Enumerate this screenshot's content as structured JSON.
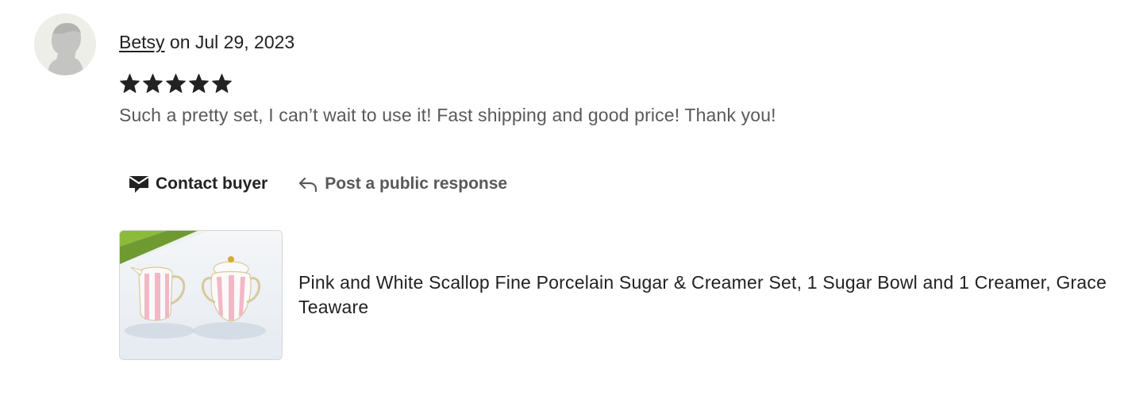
{
  "review": {
    "reviewer_name": "Betsy",
    "date_text": "on Jul 29, 2023",
    "rating": 5,
    "rating_max": 5,
    "text": "Such a pretty set, I can’t wait to use it! Fast shipping and good price! Thank you!"
  },
  "actions": {
    "contact_label": "Contact buyer",
    "public_response_label": "Post a public response"
  },
  "listing": {
    "title": "Pink and White Scallop Fine Porcelain Sugar & Creamer Set, 1 Sugar Bowl and 1 Creamer, Grace Teaware"
  },
  "icons": {
    "avatar": "default-user-avatar-icon",
    "star": "star-filled-icon",
    "contact": "envelope-message-icon",
    "reply": "reply-arrow-icon"
  },
  "colors": {
    "text_primary": "#222222",
    "text_secondary": "#595959",
    "star": "#222222",
    "avatar_bg": "#eeeee8"
  }
}
